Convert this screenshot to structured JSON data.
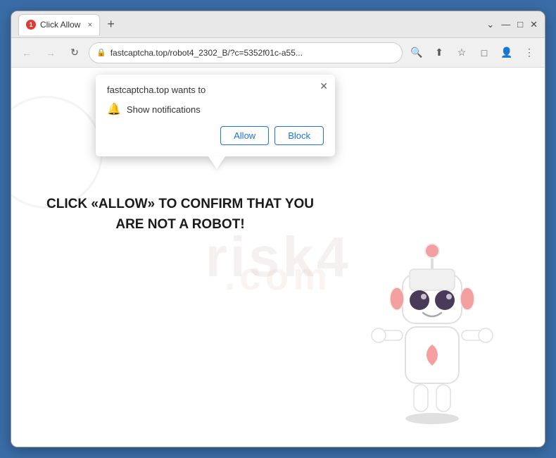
{
  "browser": {
    "tab": {
      "favicon_number": "1",
      "title": "Click Allow",
      "close_label": "×"
    },
    "new_tab_label": "+",
    "window_controls": {
      "chevron_down": "⌄",
      "minimize": "—",
      "maximize": "□",
      "close": "✕"
    },
    "toolbar": {
      "back_label": "←",
      "forward_label": "→",
      "reload_label": "↻",
      "address": "fastcaptcha.top/robot4_2302_B/?c=5352f01c-a55...",
      "lock_icon": "🔒",
      "search_icon": "🔍",
      "share_icon": "⬆",
      "bookmark_icon": "☆",
      "extension_icon": "□",
      "profile_icon": "👤",
      "menu_icon": "⋮"
    }
  },
  "popup": {
    "title": "fastcaptcha.top wants to",
    "close_label": "✕",
    "notification_row": {
      "icon": "🔔",
      "label": "Show notifications"
    },
    "allow_label": "Allow",
    "block_label": "Block"
  },
  "page": {
    "captcha_line1": "CLICK «ALLOW» TO CONFIRM THAT YOU",
    "captcha_line2": "ARE NOT A ROBOT!",
    "watermark": "risk4.com"
  }
}
